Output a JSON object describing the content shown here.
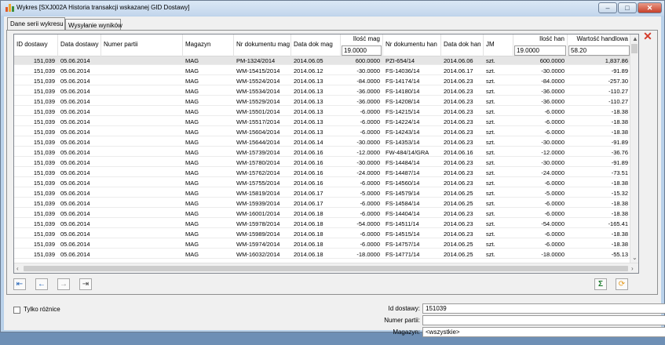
{
  "window": {
    "title": "Wykres [SXJ002A Historia transakcji wskazanej GID Dostawy]"
  },
  "tabs": [
    "Dane serii wykresu",
    "Wysyłanie wyników"
  ],
  "columns": [
    {
      "label": "ID dostawy",
      "filter": ""
    },
    {
      "label": "Data dostawy",
      "filter": ""
    },
    {
      "label": "Numer partii",
      "filter": ""
    },
    {
      "label": "Magazyn",
      "filter": ""
    },
    {
      "label": "Nr dokumentu mag",
      "filter": ""
    },
    {
      "label": "Data dok mag",
      "filter": ""
    },
    {
      "label": "Ilość mag",
      "filter": "19.0000"
    },
    {
      "label": "Nr dokumentu han",
      "filter": ""
    },
    {
      "label": "Data dok han",
      "filter": ""
    },
    {
      "label": "JM",
      "filter": ""
    },
    {
      "label": "Ilość han",
      "filter": "19.0000"
    },
    {
      "label": "Wartość handlowa",
      "filter": "58.20"
    }
  ],
  "rows": [
    [
      "151,039",
      "05.06.2014",
      "",
      "MAG",
      "PM-1324/2014",
      "2014.06.05",
      "600.0000",
      "PZI-654/14",
      "2014.06.06",
      "szt.",
      "600.0000",
      "1,837.86"
    ],
    [
      "151,039",
      "05.06.2014",
      "",
      "MAG",
      "WM-15415/2014",
      "2014.06.12",
      "-30.0000",
      "FS-14036/14",
      "2014.06.17",
      "szt.",
      "-30.0000",
      "-91.89"
    ],
    [
      "151,039",
      "05.06.2014",
      "",
      "MAG",
      "WM-15524/2014",
      "2014.06.13",
      "-84.0000",
      "FS-14174/14",
      "2014.06.23",
      "szt.",
      "-84.0000",
      "-257.30"
    ],
    [
      "151,039",
      "05.06.2014",
      "",
      "MAG",
      "WM-15534/2014",
      "2014.06.13",
      "-36.0000",
      "FS-14180/14",
      "2014.06.23",
      "szt.",
      "-36.0000",
      "-110.27"
    ],
    [
      "151,039",
      "05.06.2014",
      "",
      "MAG",
      "WM-15529/2014",
      "2014.06.13",
      "-36.0000",
      "FS-14208/14",
      "2014.06.23",
      "szt.",
      "-36.0000",
      "-110.27"
    ],
    [
      "151,039",
      "05.06.2014",
      "",
      "MAG",
      "WM-15501/2014",
      "2014.06.13",
      "-6.0000",
      "FS-14215/14",
      "2014.06.23",
      "szt.",
      "-6.0000",
      "-18.38"
    ],
    [
      "151,039",
      "05.06.2014",
      "",
      "MAG",
      "WM-15517/2014",
      "2014.06.13",
      "-6.0000",
      "FS-14224/14",
      "2014.06.23",
      "szt.",
      "-6.0000",
      "-18.38"
    ],
    [
      "151,039",
      "05.06.2014",
      "",
      "MAG",
      "WM-15604/2014",
      "2014.06.13",
      "-6.0000",
      "FS-14243/14",
      "2014.06.23",
      "szt.",
      "-6.0000",
      "-18.38"
    ],
    [
      "151,039",
      "05.06.2014",
      "",
      "MAG",
      "WM-15644/2014",
      "2014.06.14",
      "-30.0000",
      "FS-14353/14",
      "2014.06.23",
      "szt.",
      "-30.0000",
      "-91.89"
    ],
    [
      "151,039",
      "05.06.2014",
      "",
      "MAG",
      "WM-15739/2014",
      "2014.06.16",
      "-12.0000",
      "FW-484/14/GRA",
      "2014.06.16",
      "szt.",
      "-12.0000",
      "-36.76"
    ],
    [
      "151,039",
      "05.06.2014",
      "",
      "MAG",
      "WM-15780/2014",
      "2014.06.16",
      "-30.0000",
      "FS-14484/14",
      "2014.06.23",
      "szt.",
      "-30.0000",
      "-91.89"
    ],
    [
      "151,039",
      "05.06.2014",
      "",
      "MAG",
      "WM-15762/2014",
      "2014.06.16",
      "-24.0000",
      "FS-14487/14",
      "2014.06.23",
      "szt.",
      "-24.0000",
      "-73.51"
    ],
    [
      "151,039",
      "05.06.2014",
      "",
      "MAG",
      "WM-15755/2014",
      "2014.06.16",
      "-6.0000",
      "FS-14560/14",
      "2014.06.23",
      "szt.",
      "-6.0000",
      "-18.38"
    ],
    [
      "151,039",
      "05.06.2014",
      "",
      "MAG",
      "WM-15819/2014",
      "2014.06.17",
      "-5.0000",
      "FS-14579/14",
      "2014.06.25",
      "szt.",
      "-5.0000",
      "-15.32"
    ],
    [
      "151,039",
      "05.06.2014",
      "",
      "MAG",
      "WM-15939/2014",
      "2014.06.17",
      "-6.0000",
      "FS-14584/14",
      "2014.06.25",
      "szt.",
      "-6.0000",
      "-18.38"
    ],
    [
      "151,039",
      "05.06.2014",
      "",
      "MAG",
      "WM-16001/2014",
      "2014.06.18",
      "-6.0000",
      "FS-14404/14",
      "2014.06.23",
      "szt.",
      "-6.0000",
      "-18.38"
    ],
    [
      "151,039",
      "05.06.2014",
      "",
      "MAG",
      "WM-15978/2014",
      "2014.06.18",
      "-54.0000",
      "FS-14511/14",
      "2014.06.23",
      "szt.",
      "-54.0000",
      "-165.41"
    ],
    [
      "151,039",
      "05.06.2014",
      "",
      "MAG",
      "WM-15989/2014",
      "2014.06.18",
      "-6.0000",
      "FS-14515/14",
      "2014.06.23",
      "szt.",
      "-6.0000",
      "-18.38"
    ],
    [
      "151,039",
      "05.06.2014",
      "",
      "MAG",
      "WM-15974/2014",
      "2014.06.18",
      "-6.0000",
      "FS-14757/14",
      "2014.06.25",
      "szt.",
      "-6.0000",
      "-18.38"
    ],
    [
      "151,039",
      "05.06.2014",
      "",
      "MAG",
      "WM-16032/2014",
      "2014.06.18",
      "-18.0000",
      "FS-14771/14",
      "2014.06.25",
      "szt.",
      "-18.0000",
      "-55.13"
    ]
  ],
  "bottom": {
    "only_diff_label": "Tylko różnice",
    "id_label": "Id dostawy:",
    "id_value": "151039",
    "batch_label": "Numer partii:",
    "batch_value": "",
    "warehouse_label": "Magazyn:",
    "warehouse_value": "<wszystkie>"
  },
  "icons": [
    "chart-icon",
    "first-icon",
    "prev-icon",
    "next-icon",
    "last-icon",
    "sum-icon",
    "refresh-icon",
    "close-icon"
  ]
}
